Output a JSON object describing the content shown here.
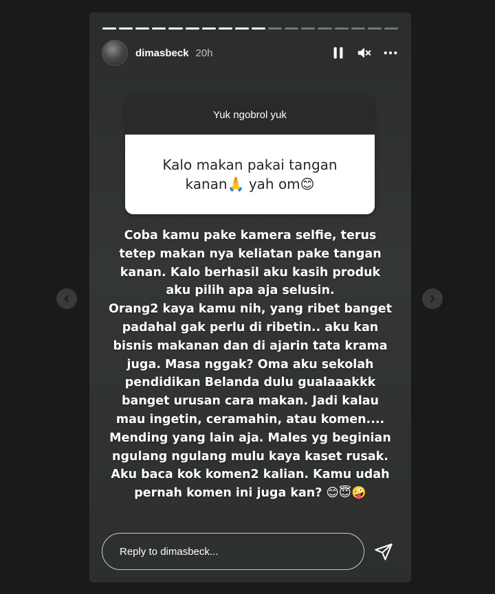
{
  "story": {
    "username": "dimasbeck",
    "time": "20h",
    "progress": {
      "total": 18,
      "viewed": 10
    }
  },
  "question_box": {
    "prompt": "Yuk ngobrol yuk",
    "answer": "Kalo makan pakai tangan kanan🙏 yah om😊"
  },
  "message": "Coba kamu pake kamera selfie, terus\ntetep makan nya keliatan pake tangan\nkanan. Kalo berhasil aku kasih  produk\naku pilih apa aja selusin.\nOrang2 kaya kamu nih, yang ribet banget\npadahal gak perlu di ribetin.. aku kan\nbisnis makanan dan di ajarin tata krama\njuga. Masa nggak? Oma aku sekolah\npendidikan Belanda dulu gualaaakkk\nbanget urusan cara makan. Jadi kalau\nmau ingetin, ceramahin, atau komen....\nMending yang lain aja. Males yg beginian\nngulang ngulang mulu kaya kaset rusak.\nAku baca kok komen2 kalian. Kamu udah\npernah komen ini juga kan?  😊😇🤪",
  "reply": {
    "placeholder": "Reply to dimasbeck..."
  },
  "icons": {
    "pause": "pause-icon",
    "mute": "speaker-muted-icon",
    "more": "more-options-icon",
    "send": "send-icon",
    "prev": "chevron-left-icon",
    "next": "chevron-right-icon"
  },
  "colors": {
    "story_bg": "#2b2e2c",
    "page_bg": "#1a1a1a",
    "text": "#ffffff"
  }
}
